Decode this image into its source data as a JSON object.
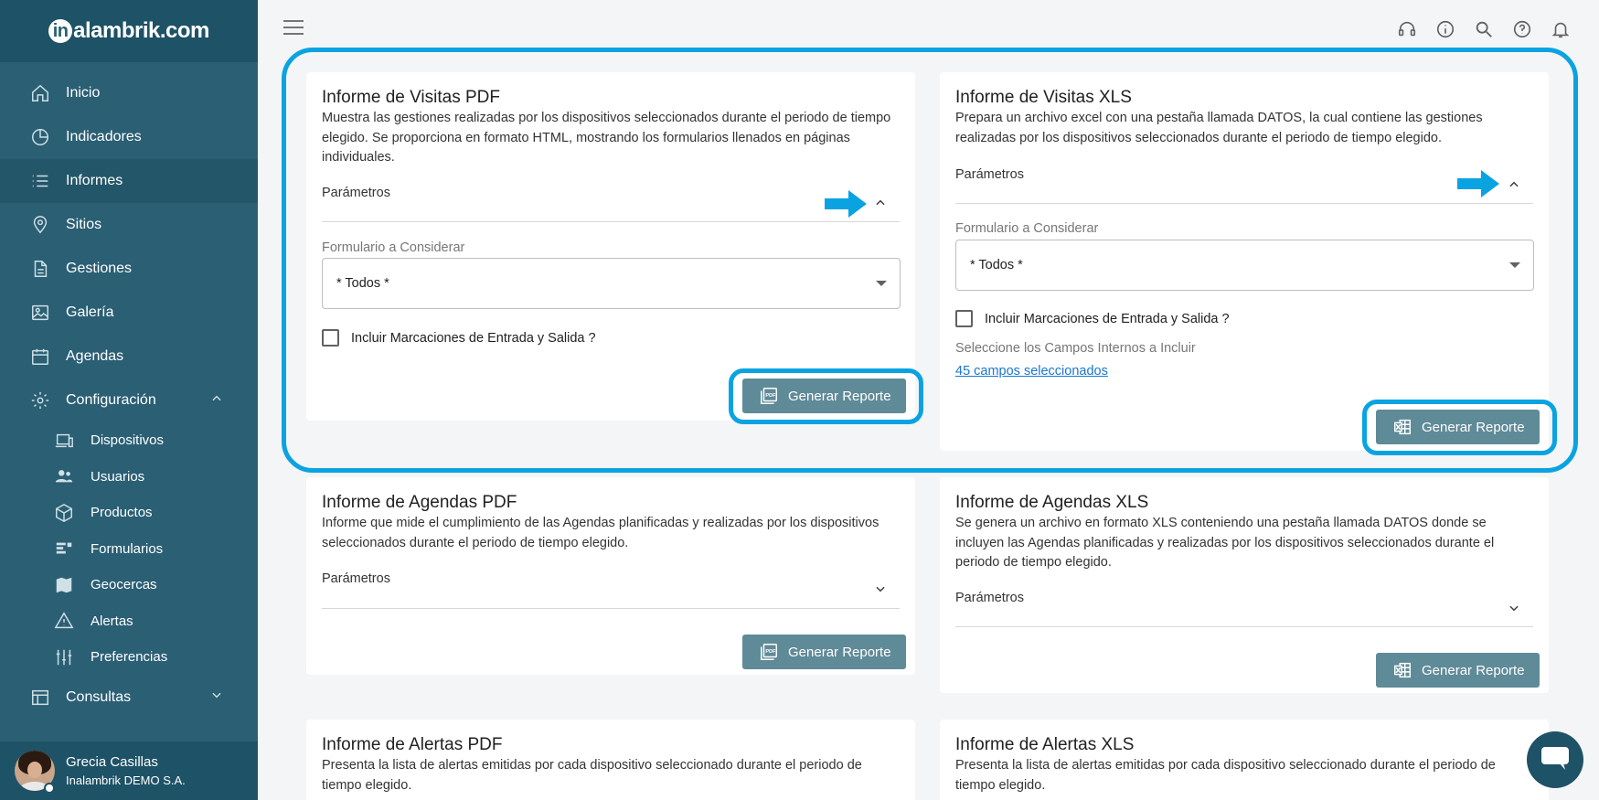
{
  "app": {
    "logo_text": "alambrik.com",
    "logo_letter": "in"
  },
  "sidebar": {
    "items": [
      {
        "label": "Inicio",
        "icon": "home-icon"
      },
      {
        "label": "Indicadores",
        "icon": "pie-chart-icon"
      },
      {
        "label": "Informes",
        "icon": "list-icon",
        "active": true
      },
      {
        "label": "Sitios",
        "icon": "location-icon"
      },
      {
        "label": "Gestiones",
        "icon": "document-icon"
      },
      {
        "label": "Galería",
        "icon": "image-icon"
      },
      {
        "label": "Agendas",
        "icon": "calendar-icon"
      },
      {
        "label": "Configuración",
        "icon": "gear-icon",
        "expanded": true
      }
    ],
    "sub_items": [
      {
        "label": "Dispositivos",
        "icon": "devices-icon"
      },
      {
        "label": "Usuarios",
        "icon": "users-icon"
      },
      {
        "label": "Productos",
        "icon": "box-icon"
      },
      {
        "label": "Formularios",
        "icon": "form-icon"
      },
      {
        "label": "Geocercas",
        "icon": "map-icon"
      },
      {
        "label": "Alertas",
        "icon": "warning-icon"
      },
      {
        "label": "Preferencias",
        "icon": "sliders-icon"
      }
    ],
    "consultas_label": "Consultas",
    "user": {
      "name": "Grecia Casillas",
      "org": "Inalambrik DEMO S.A."
    }
  },
  "cards": {
    "visitas_pdf": {
      "title": "Informe de Visitas PDF",
      "desc": "Muestra las gestiones realizadas por los dispositivos seleccionados durante el periodo de tiempo elegido. Se proporciona en formato HTML, mostrando los formularios llenados en páginas individuales.",
      "params_label": "Parámetros",
      "form_label": "Formulario a Considerar",
      "form_value": "* Todos *",
      "check_label": "Incluir Marcaciones de Entrada y Salida ?",
      "button": "Generar Reporte"
    },
    "visitas_xls": {
      "title": "Informe de Visitas XLS",
      "desc": "Prepara un archivo excel con una pestaña llamada DATOS, la cual contiene las gestiones realizadas por los dispositivos seleccionados durante el periodo de tiempo elegido.",
      "params_label": "Parámetros",
      "form_label": "Formulario a Considerar",
      "form_value": "* Todos *",
      "check_label": "Incluir Marcaciones de Entrada y Salida ?",
      "fields_label": "Seleccione los Campos Internos a Incluir",
      "fields_link": "45 campos seleccionados",
      "button": "Generar Reporte"
    },
    "agendas_pdf": {
      "title": "Informe de Agendas PDF",
      "desc": "Informe que mide el cumplimiento de las Agendas planificadas y realizadas por los dispositivos seleccionados durante el periodo de tiempo elegido.",
      "params_label": "Parámetros",
      "button": "Generar Reporte"
    },
    "agendas_xls": {
      "title": "Informe de Agendas XLS",
      "desc": "Se genera un archivo en formato XLS conteniendo una pestaña llamada DATOS donde se incluyen las Agendas planificadas y realizadas por los dispositivos seleccionados durante el periodo de tiempo elegido.",
      "params_label": "Parámetros",
      "button": "Generar Reporte"
    },
    "alertas_pdf": {
      "title": "Informe de Alertas PDF",
      "desc": "Presenta la lista de alertas emitidas por cada dispositivo seleccionado durante el periodo de tiempo elegido."
    },
    "alertas_xls": {
      "title": "Informe de Alertas XLS",
      "desc": "Presenta la lista de alertas emitidas por cada dispositivo seleccionado durante el periodo de tiempo elegido."
    }
  },
  "colors": {
    "sidebar": "#2a5f74",
    "button": "#5f8a98",
    "highlight": "#0aa3e2",
    "link": "#1976d2"
  }
}
